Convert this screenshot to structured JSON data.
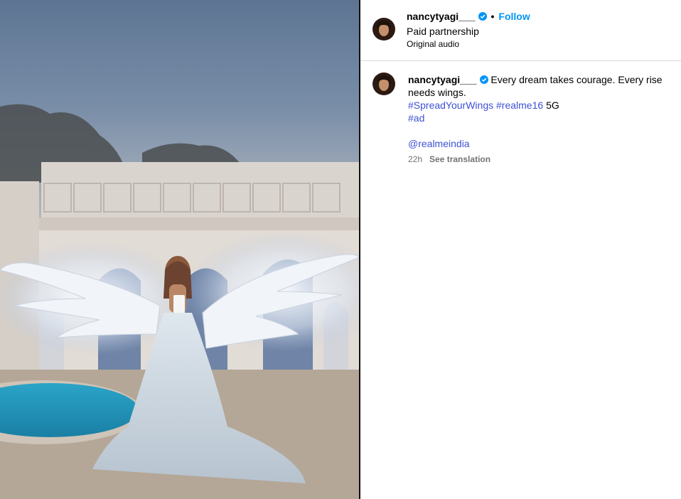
{
  "post": {
    "username": "nancytyagi___",
    "verified_icon": "verified-badge-icon",
    "follow_label": "Follow",
    "separator": "•",
    "paid_partnership": "Paid partnership",
    "audio": "Original audio",
    "image_description_icon": "post-image"
  },
  "caption": {
    "username": "nancytyagi___",
    "text_line": "Every dream takes courage. Every rise needs wings.",
    "hashtag1": "#SpreadYourWings",
    "hashtag2": "#realme16",
    "suffix": "5G",
    "hashtag3": "#ad",
    "mention": "@realmeindia",
    "time": "22h",
    "see_translation": "See translation"
  },
  "colors": {
    "link": "#3f51d6",
    "follow": "#0095f6",
    "muted": "#737373",
    "verified": "#0095f6"
  }
}
